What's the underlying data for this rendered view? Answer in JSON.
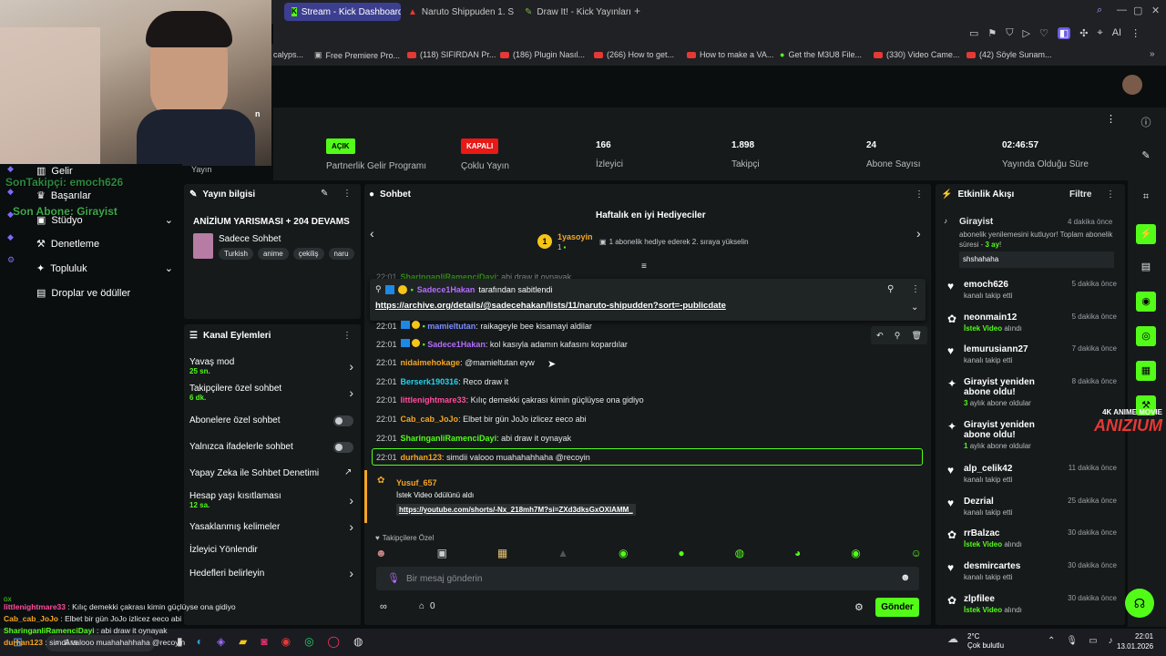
{
  "browser": {
    "tabs": [
      {
        "label": "Stream - Kick Dashboard",
        "active": true
      },
      {
        "label": "Naruto Shippuden 1. Sezo"
      },
      {
        "label": "Draw It! - Kick Yayınları İç"
      }
    ],
    "bookmarks": [
      "calyps...",
      "Free Premiere Pro...",
      "(118) SIFIRDAN Pr...",
      "(186) Plugin Nasıl...",
      "(266) How to get...",
      "How to make a VA...",
      "Get the M3U8 File...",
      "(330) Video Came...",
      "(42) Söyle Sunam..."
    ]
  },
  "stats": [
    {
      "value": "AÇIK",
      "label": "Partnerlik Gelir Programı",
      "pill": true,
      "color": "#53fc18"
    },
    {
      "value": "KAPALI",
      "label": "Çoklu Yayın",
      "pill": true,
      "color": "#e91916"
    },
    {
      "value": "166",
      "label": "İzleyici"
    },
    {
      "value": "1.898",
      "label": "Takipçi"
    },
    {
      "value": "24",
      "label": "Abone Sayısı"
    },
    {
      "value": "02:46:57",
      "label": "Yayında Olduğu Süre"
    }
  ],
  "stats_left_label": "Yayın",
  "leftnav": {
    "items": [
      "Gelir",
      "Başarılar",
      "Stüdyo",
      "Denetleme",
      "Topluluk",
      "Droplar ve ödüller"
    ]
  },
  "overlay": {
    "follower": "SonTakipçi: emoch626",
    "subscriber": "Son Abone: Girayist"
  },
  "stream_info": {
    "header": "Yayın bilgisi",
    "title": "ANİZİUM YARISMASI + 204 DEVAMS",
    "category": "Sadece Sohbet",
    "tags": [
      "Turkish",
      "anime",
      "çekiliş",
      "naru"
    ]
  },
  "channel_actions": {
    "header": "Kanal Eylemleri",
    "items": [
      {
        "label": "Yavaş mod",
        "sub": "25 sn.",
        "control": "arrow"
      },
      {
        "label": "Takipçilere özel sohbet",
        "sub": "6 dk.",
        "control": "arrow"
      },
      {
        "label": "Abonelere özel sohbet",
        "control": "toggle"
      },
      {
        "label": "Yalnızca ifadelerle sohbet",
        "control": "toggle"
      },
      {
        "label": "Yapay Zeka ile Sohbet Denetimi",
        "control": "link"
      },
      {
        "label": "Hesap yaşı kısıtlaması",
        "sub": "12 sa.",
        "control": "arrow"
      },
      {
        "label": "Yasaklanmış kelimeler",
        "control": "arrow"
      },
      {
        "label": "İzleyici Yönlendir",
        "control": "none"
      },
      {
        "label": "Hedefleri belirleyin",
        "control": "arrow"
      }
    ]
  },
  "chat": {
    "header": "Sohbet",
    "gifters_title": "Haftalık en iyi Hediyeciler",
    "top_gifter": "1yasoyin",
    "top_gifter_count": "1",
    "top_gifter_text": "1 abonelik hediye ederek 2. sıraya yükselin",
    "pinned_by": "Sadece1Hakan",
    "pinned_label": "tarafından sabitlendi",
    "pinned_link": "https://archive.org/details/@sadecehakan/lists/11/naruto-shipudden?sort=-publicdate",
    "messages": [
      {
        "time": "22:01",
        "user": "SharinganliRamenciDayi",
        "text": "abi draw it oynayak",
        "color": "#53fc18"
      },
      {
        "time": "22:01",
        "user": "mamieltutan",
        "text": "raikageyle bee kisamayi aldilar",
        "color": "#7b8cff"
      },
      {
        "time": "22:01",
        "user": "Sadece1Hakan",
        "text": "kol kasıyla adamın kafasını kopardılar",
        "color": "#b46cff"
      },
      {
        "time": "22:01",
        "user": "nidaimehokage",
        "text": "@mamieltutan eyw",
        "color": "#f5a623"
      },
      {
        "time": "22:01",
        "user": "Berserk190316",
        "text": "Reco draw it",
        "color": "#22d3ee"
      },
      {
        "time": "22:01",
        "user": "littlenightmare33",
        "text": "Kılıç demekki çakrası kimin güçlüyse ona gidiyo",
        "color": "#ff4d9d"
      },
      {
        "time": "22:01",
        "user": "Cab_cab_JoJo",
        "text": "Elbet bir gün JoJo izlicez eeco abi",
        "color": "#f5a623"
      },
      {
        "time": "22:01",
        "user": "SharinganliRamenciDayi",
        "text": "abi draw it oynayak",
        "color": "#53fc18"
      },
      {
        "time": "22:01",
        "user": "durhan123",
        "text": "simdii valooo muahahahhaha @recoyin",
        "color": "#f5a623"
      }
    ],
    "reward_user": "Yusuf_657",
    "reward_text": "İstek Video ödülünü aldı",
    "reward_link": "https://youtube.com/shorts/-Nx_218mh7M?si=ZXd3dksGxOXIAMM_",
    "followers_only": "Takipçilere Özel",
    "input_placeholder": "Bir mesaj gönderin",
    "points": "0",
    "send_label": "Gönder"
  },
  "activity": {
    "header": "Etkinlik Akışı",
    "filter": "Filtre",
    "featured": {
      "name": "Girayist",
      "time": "4 dakika önce",
      "text_before": "abonelik yenilemesini kutluyor! Toplam abonelik süresi - ",
      "text_highlight": "3 ay",
      "text_after": "!",
      "message": "shshahaha"
    },
    "items": [
      {
        "name": "emoch626",
        "sub": "kanalı takip etti",
        "time": "5 dakika önce",
        "icon": "heart"
      },
      {
        "name": "neonmain12",
        "sub_highlight": "İstek Video",
        "sub": "alındı",
        "time": "5 dakika önce",
        "icon": "reward"
      },
      {
        "name": "lemurusiann27",
        "sub": "kanalı takip etti",
        "time": "7 dakika önce",
        "icon": "heart"
      },
      {
        "name": "Girayist yeniden abone oldu!",
        "sub_highlight": "3",
        "sub": "aylık abone oldular",
        "time": "8 dakika önce",
        "icon": "star"
      },
      {
        "name": "Girayist yeniden abone oldu!",
        "sub_highlight": "1",
        "sub": "aylık abone oldular",
        "time": "",
        "icon": "star"
      },
      {
        "name": "alp_celik42",
        "sub": "kanalı takip etti",
        "time": "11 dakika önce",
        "icon": "heart"
      },
      {
        "name": "Dezrial",
        "sub": "kanalı takip etti",
        "time": "25 dakika önce",
        "icon": "heart"
      },
      {
        "name": "rrBalzac",
        "sub_highlight": "İstek Video",
        "sub": "alındı",
        "time": "30 dakika önce",
        "icon": "reward"
      },
      {
        "name": "desmircartes",
        "sub": "kanalı takip etti",
        "time": "30 dakika önce",
        "icon": "heart"
      },
      {
        "name": "zlpfilee",
        "sub_highlight": "İstek Video",
        "sub": "alındı",
        "time": "30 dakika önce",
        "icon": "reward"
      }
    ]
  },
  "watermark": {
    "line1": "4K ANIME MOVIE",
    "line2": "ANIZIUM"
  },
  "overlay_chat": [
    {
      "user": "littlenightmare33",
      "text": "Kılıç demekki çakrası kimin güçlüyse ona gidiyo",
      "color": "#ff4d9d"
    },
    {
      "user": "Cab_cab_JoJo",
      "text": "Elbet bir gün JoJo izlicez eeco abi",
      "color": "#f5a623"
    },
    {
      "user": "SharinganliRamenciDayi",
      "text": "abi draw it oynayak",
      "color": "#53fc18"
    },
    {
      "user": "durhan123",
      "text": "simdii valooo muahahahhaha @recoyin",
      "color": "#f5a623"
    }
  ],
  "taskbar": {
    "search": "Ara",
    "weather_temp": "2°C",
    "weather_desc": "Çok bulutlu",
    "time": "22:01",
    "date": "13.01.2026"
  },
  "colors": {
    "accent": "#53fc18",
    "danger": "#e91916"
  }
}
